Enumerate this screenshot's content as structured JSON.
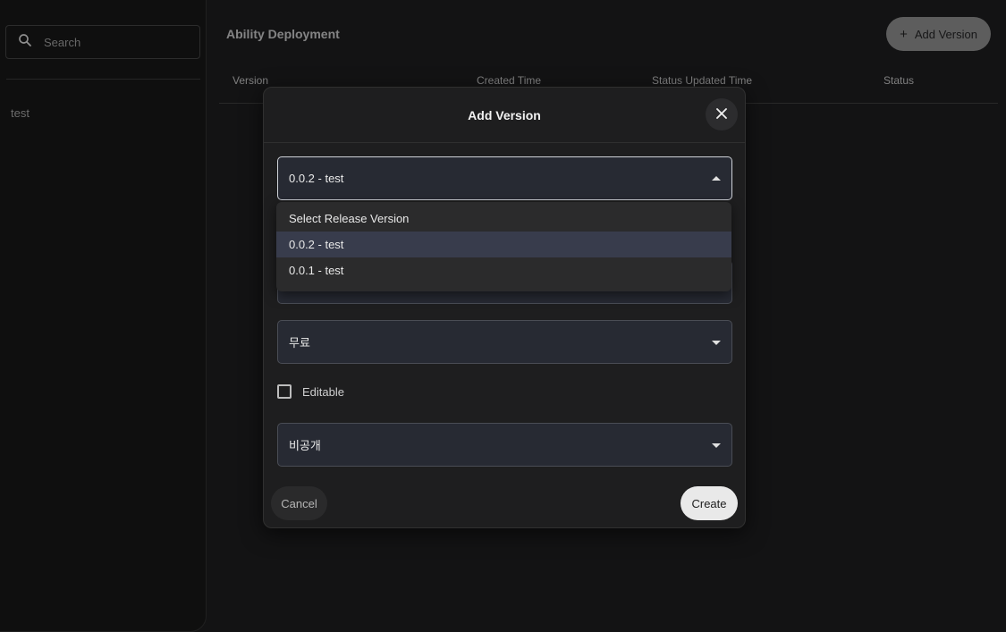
{
  "sidebar": {
    "search_placeholder": "Search",
    "items": [
      {
        "label": "test"
      }
    ]
  },
  "main": {
    "title": "Ability Deployment",
    "add_button_label": "Add Version",
    "table": {
      "columns": [
        "Version",
        "Created Time",
        "Status Updated Time",
        "Status"
      ]
    }
  },
  "modal": {
    "title": "Add Version",
    "release_select_value": "0.0.2 - test",
    "release_options": [
      {
        "label": "Select Release Version",
        "selected": false
      },
      {
        "label": "0.0.2 - test",
        "selected": true
      },
      {
        "label": "0.0.1 - test",
        "selected": false
      }
    ],
    "price_select_value": "무료",
    "editable_label": "Editable",
    "editable_checked": false,
    "visibility_select_value": "비공개",
    "cancel_label": "Cancel",
    "create_label": "Create"
  },
  "colors": {
    "background": "#131314",
    "modal_background": "#1e1e1f",
    "field_background": "#272a33",
    "selected_option": "#383c4c",
    "primary_button": "#e9e9e9"
  }
}
